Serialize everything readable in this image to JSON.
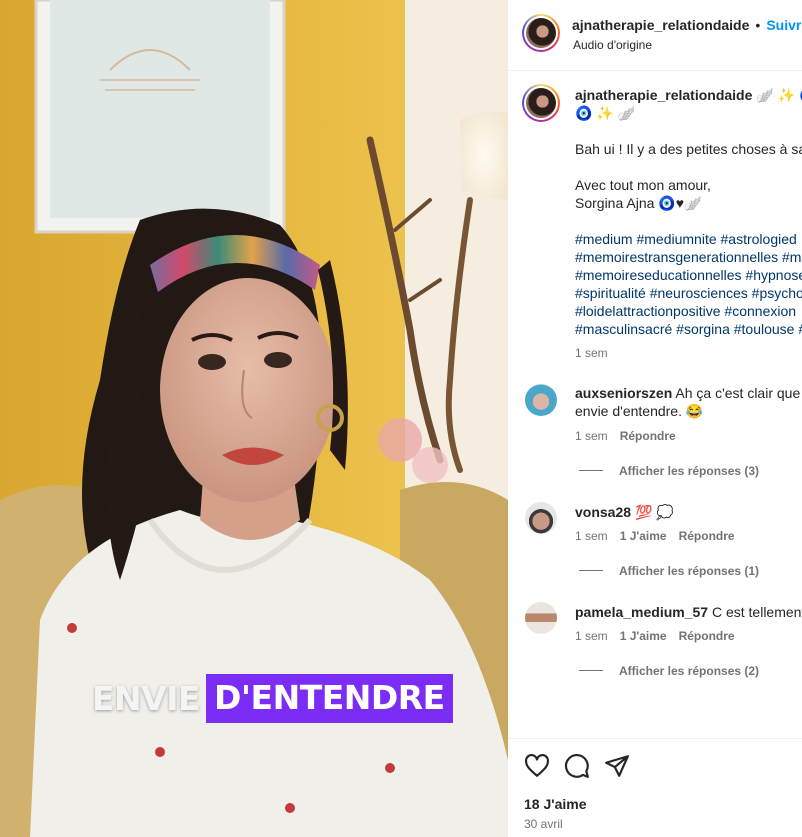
{
  "video": {
    "caption_left": "ENVIE",
    "caption_right": "D'ENTENDRE",
    "colors": {
      "caption_highlight": "#7b2cf5",
      "wall": "#e2b339"
    }
  },
  "header": {
    "username": "ajnatherapie_relationdaide",
    "separator": "•",
    "follow_label": "Suivre",
    "audio_label": "Audio d'origine"
  },
  "post": {
    "username": "ajnatherapie_relationdaide",
    "emoji_inline": "🪽 ✨ 🧿",
    "emoji_line2": "🧿 ✨ 🪽",
    "line1": "Bah ui ! Il y a des petites choses à sav",
    "line2": "Avec tout mon amour,",
    "line3": "Sorgina Ajna 🧿♥🪽",
    "hashtags": [
      "#medium #mediumnite #astrologied",
      "#memoirestransgenerationnelles #m",
      "#memoireseducationnelles #hypnose",
      "#spiritualité #neurosciences #psycho",
      "#loidelattractionpositive #connexion",
      "#masculinsacré #sorgina #toulouse #"
    ],
    "time": "1 sem"
  },
  "comments": [
    {
      "username": "auxseniorszen",
      "text_line1": "Ah ça c'est clair que tu",
      "text_line2": "envie d'entendre. 😂",
      "time": "1 sem",
      "likes": "",
      "reply": "Répondre",
      "view_replies": "Afficher les réponses (3)"
    },
    {
      "username": "vonsa28",
      "text_line1": "💯 💭",
      "text_line2": "",
      "time": "1 sem",
      "likes": "1 J'aime",
      "reply": "Répondre",
      "view_replies": "Afficher les réponses (1)"
    },
    {
      "username": "pamela_medium_57",
      "text_line1": "C est tellement",
      "text_line2": "",
      "time": "1 sem",
      "likes": "1 J'aime",
      "reply": "Répondre",
      "view_replies": "Afficher les réponses (2)"
    }
  ],
  "footer": {
    "likes": "18 J'aime",
    "date": "30 avril",
    "icons": [
      "heart-icon",
      "comment-icon",
      "share-icon"
    ]
  }
}
